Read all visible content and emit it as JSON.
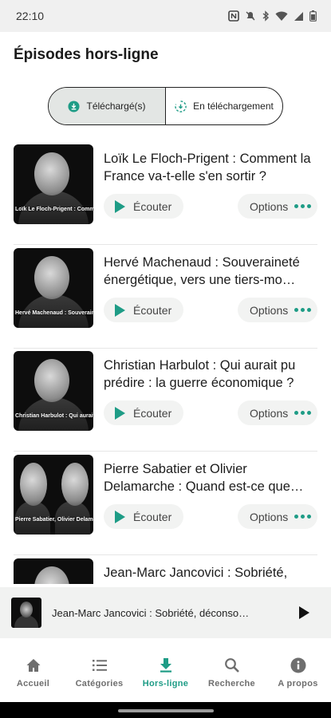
{
  "status_bar": {
    "time": "22:10",
    "icons": [
      "nfc-icon",
      "mute-icon",
      "bluetooth-icon",
      "wifi-icon",
      "signal-icon",
      "battery-icon"
    ]
  },
  "page": {
    "title": "Épisodes hors-ligne"
  },
  "tabs": [
    {
      "label": "Téléchargé(s)",
      "icon": "download-circle-icon",
      "selected": true
    },
    {
      "label": "En téléchargement",
      "icon": "downloading-icon",
      "selected": false
    }
  ],
  "episodes": [
    {
      "title": "Loïk Le Floch-Prigent : Comment la France va-t-elle s'en sortir ?",
      "thumb_caption": "Loïk Le Floch-Prigent : Comment la France va-t-elle s'en sortir ?",
      "listen_label": "Écouter",
      "options_label": "Options"
    },
    {
      "title": "Hervé Machenaud : Souveraineté énergétique, vers une tiers-mo…",
      "thumb_caption": "Hervé Machenaud : Souveraineté énergétique vers une tiers-mondisation",
      "listen_label": "Écouter",
      "options_label": "Options"
    },
    {
      "title": "Christian Harbulot : Qui aurait pu prédire : la guerre économique ?",
      "thumb_caption": "Christian Harbulot : Qui aurait pu prédire : la guerre économique",
      "listen_label": "Écouter",
      "options_label": "Options"
    },
    {
      "title": "Pierre Sabatier et Olivier Delamarche : Quand est-ce que…",
      "thumb_caption": "Pierre Sabatier, Olivier Delamarche : Quand est-ce que l'on touche le fond ?",
      "listen_label": "Écouter",
      "options_label": "Options"
    },
    {
      "title": "Jean-Marc Jancovici : Sobriété, déconsommation",
      "thumb_caption": "",
      "listen_label": "Écouter",
      "options_label": "Options"
    }
  ],
  "mini_player": {
    "title": "Jean-Marc Jancovici : Sobriété, déconso…"
  },
  "bottom_nav": [
    {
      "label": "Accueil",
      "icon": "home-icon",
      "active": false
    },
    {
      "label": "Catégories",
      "icon": "list-icon",
      "active": false
    },
    {
      "label": "Hors-ligne",
      "icon": "download-icon",
      "active": true
    },
    {
      "label": "Recherche",
      "icon": "search-icon",
      "active": false
    },
    {
      "label": "A propos",
      "icon": "info-icon",
      "active": false
    }
  ],
  "colors": {
    "accent": "#1e9c86",
    "segment_active_bg": "#e3e6e4",
    "button_bg": "#f2f3f2",
    "mini_player_bg": "#f1f2f1"
  }
}
